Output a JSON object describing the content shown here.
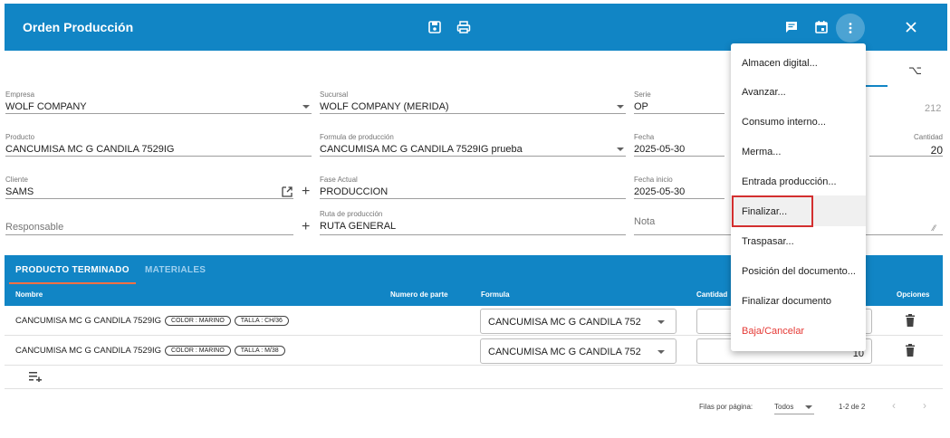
{
  "header": {
    "title": "Orden Producción",
    "icons": [
      "save-icon",
      "print-icon",
      "comment-icon",
      "calendar-icon",
      "more-vert-icon",
      "close-icon"
    ],
    "bg_color": "#1185c5"
  },
  "form": {
    "empresa": {
      "label": "Empresa",
      "value": "WOLF COMPANY"
    },
    "sucursal": {
      "label": "Sucursal",
      "value": "WOLF COMPANY (MERIDA)"
    },
    "serie": {
      "label": "Serie",
      "value": "OP",
      "folio": "212"
    },
    "producto": {
      "label": "Producto",
      "value": "CANCUMISA MC G CANDILA 7529IG"
    },
    "formula": {
      "label": "Formula de producción",
      "value": "CANCUMISA MC G CANDILA 7529IG prueba"
    },
    "fecha": {
      "label": "Fecha",
      "value": "2025-05-30"
    },
    "cantidad": {
      "label": "Cantidad",
      "value": "20"
    },
    "cliente": {
      "label": "Cliente",
      "value": "SAMS"
    },
    "fase_actual": {
      "label": "Fase Actual",
      "value": "PRODUCCION"
    },
    "fecha_inicio": {
      "label": "Fecha inicio",
      "value": "2025-05-30"
    },
    "responsable": {
      "placeholder": "Responsable"
    },
    "ruta": {
      "label": "Ruta de producción",
      "value": "RUTA GENERAL"
    },
    "nota": {
      "placeholder": "Nota"
    }
  },
  "tabs": [
    {
      "label": "PRODUCTO TERMINADO",
      "active": true
    },
    {
      "label": "MATERIALES",
      "active": false
    }
  ],
  "table": {
    "columns": [
      "Nombre",
      "Numero de parte",
      "Formula",
      "Cantidad",
      "Opciones"
    ],
    "rows": [
      {
        "name": "CANCUMISA MC G CANDILA 7529IG",
        "chips": [
          "COLOR : MARINO",
          "TALLA : CH/36"
        ],
        "formula": "CANCUMISA MC G CANDILA 752",
        "qty": ""
      },
      {
        "name": "CANCUMISA MC G CANDILA 7529IG",
        "chips": [
          "COLOR : MARINO",
          "TALLA : M/38"
        ],
        "formula": "CANCUMISA MC G CANDILA 752",
        "qty": "10"
      }
    ]
  },
  "pagination": {
    "rows_per_page_label": "Filas por página:",
    "rows_per_page_value": "Todos",
    "range": "1-2 de 2"
  },
  "menu": {
    "items": [
      {
        "label": "Almacen digital...",
        "danger": false
      },
      {
        "label": "Avanzar...",
        "danger": false
      },
      {
        "label": "Consumo interno...",
        "danger": false
      },
      {
        "label": "Merma...",
        "danger": false
      },
      {
        "label": "Entrada producción...",
        "danger": false
      },
      {
        "label": "Finalizar...",
        "danger": false
      },
      {
        "label": "Traspasar...",
        "danger": false
      },
      {
        "label": "Posición del documento...",
        "danger": false
      },
      {
        "label": "Finalizar documento",
        "danger": false
      },
      {
        "label": "Baja/Cancelar",
        "danger": true
      }
    ],
    "danger_color": "#e53935",
    "highlight_color": "#d32f2f"
  }
}
